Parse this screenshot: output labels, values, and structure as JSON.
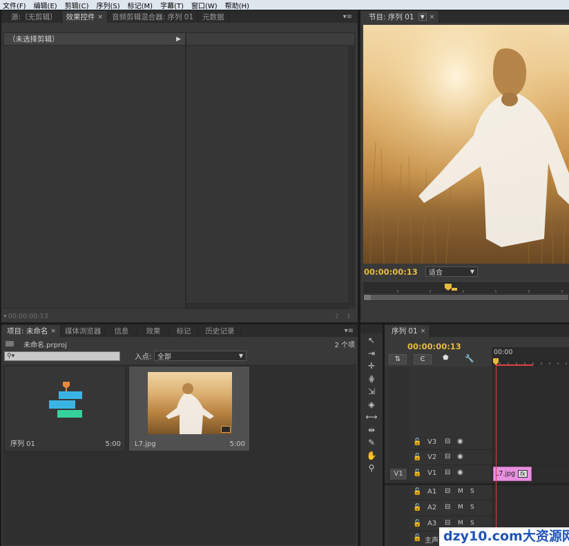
{
  "menu": [
    "文件(F)",
    "编辑(E)",
    "剪辑(C)",
    "序列(S)",
    "标记(M)",
    "字幕(T)",
    "窗口(W)",
    "帮助(H)"
  ],
  "source_panel": {
    "tabs": [
      {
        "label": "源:（无剪辑）",
        "active": false
      },
      {
        "label": "效果控件",
        "active": true
      },
      {
        "label": "音频剪辑混合器: 序列 01",
        "active": false
      },
      {
        "label": "元数据",
        "active": false
      }
    ],
    "no_clip": "（未选择剪辑）",
    "timecode": "00:00:00:13"
  },
  "program_panel": {
    "tab_label": "节目: 序列 01",
    "timecode": "00:00:00:13",
    "fit_label": "适合",
    "image_desc": "girl-in-wheat-field"
  },
  "project_panel": {
    "tabs": [
      {
        "label": "项目: 未命名",
        "active": true
      },
      {
        "label": "媒体浏览器",
        "active": false
      },
      {
        "label": "信息",
        "active": false
      },
      {
        "label": "效果",
        "active": false
      },
      {
        "label": "标记",
        "active": false
      },
      {
        "label": "历史记录",
        "active": false
      }
    ],
    "project_file": "未命名.prproj",
    "item_count": "2 个项",
    "search_placeholder": "",
    "inpoint_label": "入点:",
    "inpoint_value": "全部",
    "items": [
      {
        "name": "序列 01",
        "duration": "5:00",
        "kind": "sequence"
      },
      {
        "name": "L7.jpg",
        "duration": "5:00",
        "kind": "image"
      }
    ]
  },
  "timeline": {
    "tab_label": "序列 01",
    "timecode": "00:00:00:13",
    "ruler_label": "00:00",
    "source_patch": "V1",
    "video_tracks": [
      "V3",
      "V2",
      "V1"
    ],
    "audio_tracks": [
      "A1",
      "A2",
      "A3"
    ],
    "master_label": "主声道",
    "clip_label": "L7.jpg",
    "fx_label": "fx",
    "mute_label": "M",
    "solo_label": "S"
  },
  "watermark": "dzy10.com大资源网",
  "colors": {
    "accent": "#e7ba3f",
    "playhead": "#e34040",
    "clip": "#e88fe0"
  }
}
